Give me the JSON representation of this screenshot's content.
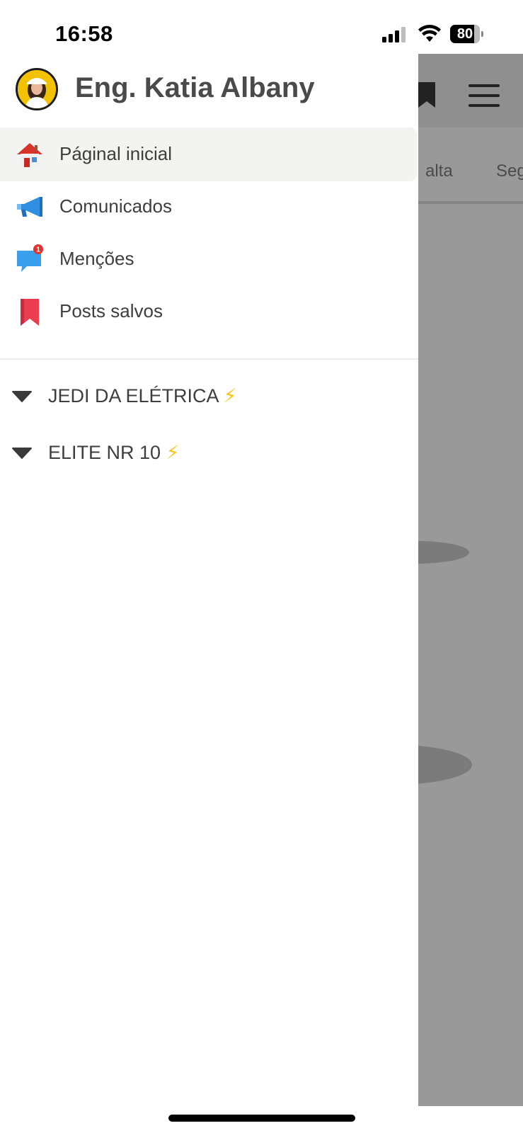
{
  "status_bar": {
    "time": "16:58",
    "battery_level": "80",
    "battery_fraction": 0.8
  },
  "drawer": {
    "user": {
      "name": "Eng. Katia Albany"
    },
    "nav_items": [
      {
        "label": "Páginal inicial",
        "icon": "house-icon",
        "active": true
      },
      {
        "label": "Comunicados",
        "icon": "megaphone-icon",
        "active": false
      },
      {
        "label": "Menções",
        "icon": "speech-bubble-icon",
        "badge": "1",
        "active": false
      },
      {
        "label": "Posts salvos",
        "icon": "bookmark-icon",
        "active": false
      }
    ],
    "groups": [
      {
        "label": "JEDI DA ELÉTRICA",
        "emoji": "⚡",
        "expanded": true
      },
      {
        "label": "ELITE NR 10",
        "emoji": "⚡",
        "expanded": true
      }
    ]
  },
  "background_app": {
    "tabs": [
      "alta",
      "Seg"
    ]
  },
  "colors": {
    "overlay": "#999999",
    "active_item_bg": "#f3f3f2",
    "text": "#3e3e3e",
    "badge_red": "#e5322d",
    "bolt_yellow": "#f5c518"
  }
}
